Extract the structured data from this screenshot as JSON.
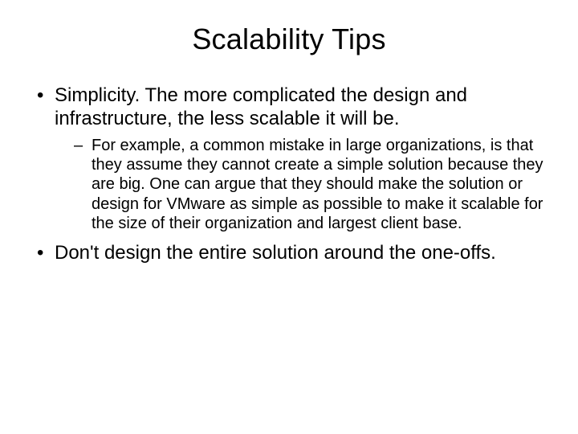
{
  "title": "Scalability Tips",
  "bullets": {
    "b1": "Simplicity. The more complicated the design and infrastructure, the less scalable it will be.",
    "b1_sub1": "For example, a common mistake in large organizations, is that they assume they cannot create a simple solution because they are big. One can argue that they should make the solution or design for VMware as simple as possible to make it scalable for the size of their organization and largest client base.",
    "b2": "Don't design the entire solution around the one-offs."
  }
}
